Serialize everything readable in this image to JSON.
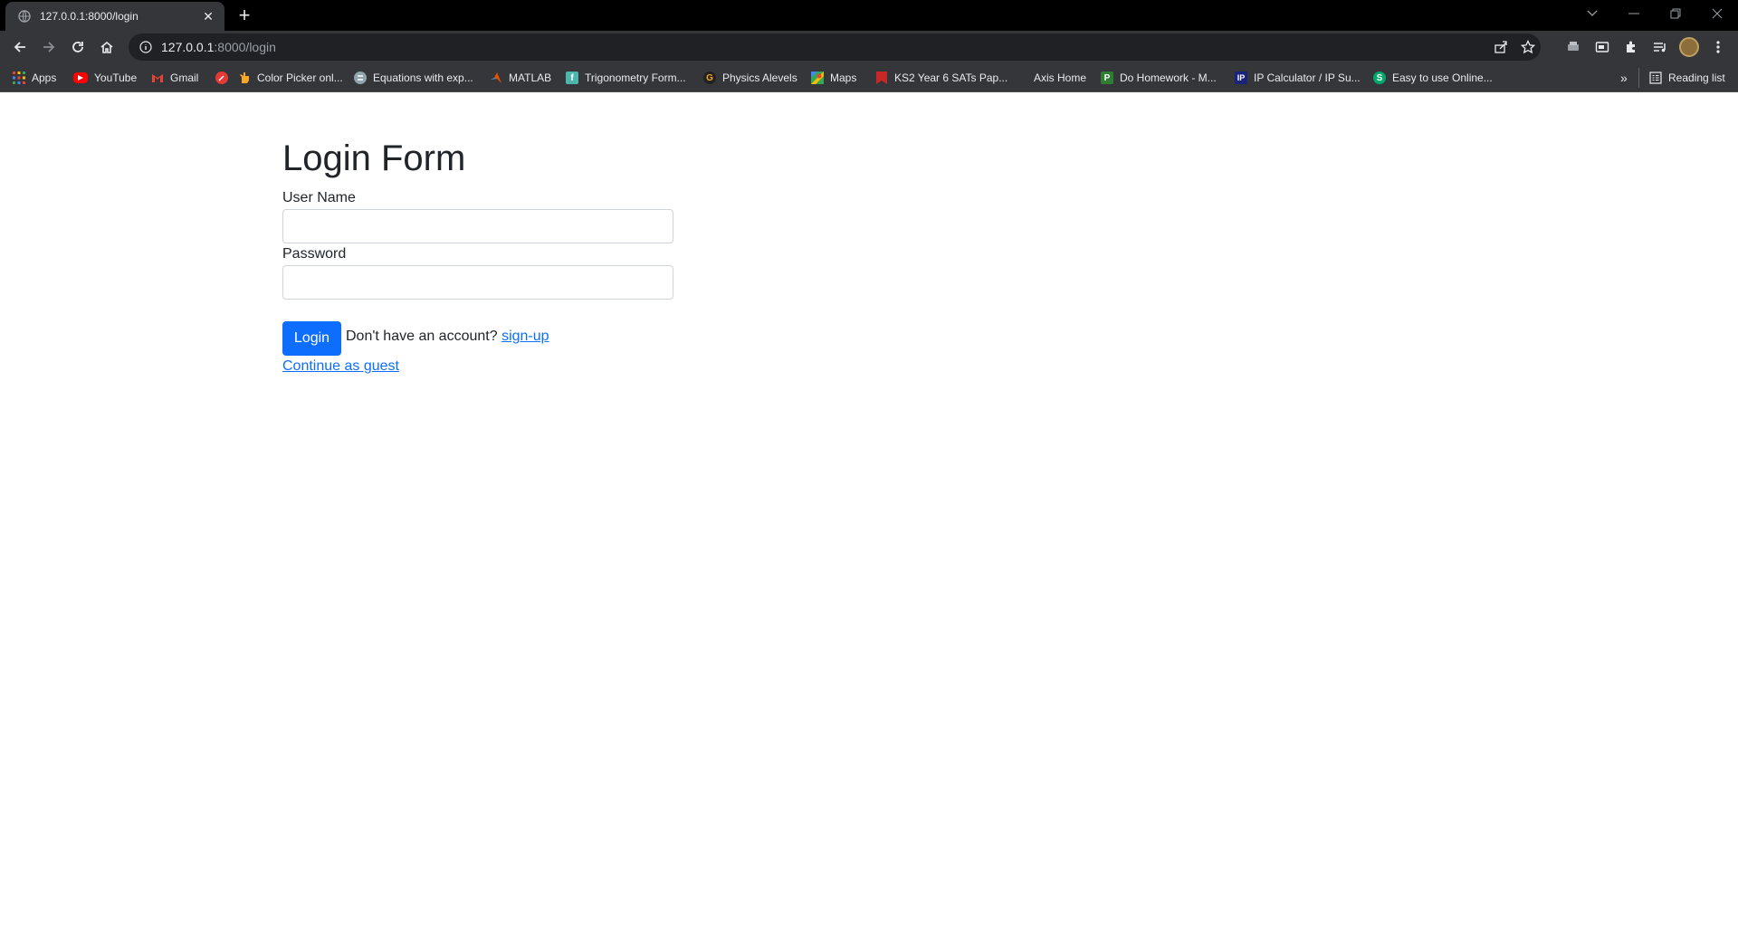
{
  "browser": {
    "tab_title": "127.0.0.1:8000/login",
    "url_host": "127.0.0.1",
    "url_path": ":8000/login",
    "bookmarks": [
      {
        "label": "Apps",
        "icon": "apps-grid-icon",
        "color": "#ea4335"
      },
      {
        "label": "YouTube",
        "icon": "youtube-icon",
        "color": "#ff0000"
      },
      {
        "label": "Gmail",
        "icon": "gmail-icon",
        "color": "#ea4335"
      },
      {
        "label": "",
        "icon": "color-picker-icon",
        "color": "#e53935"
      },
      {
        "label": "Color Picker onl...",
        "icon": "hand-icon",
        "color": "#f9a825"
      },
      {
        "label": "Equations with exp...",
        "icon": "equations-icon",
        "color": "#78909c"
      },
      {
        "label": "MATLAB",
        "icon": "matlab-icon",
        "color": "#e65100"
      },
      {
        "label": "Trigonometry Form...",
        "icon": "trig-icon",
        "color": "#26a69a"
      },
      {
        "label": "Physics Alevels",
        "icon": "physics-icon",
        "color": "#424242"
      },
      {
        "label": "Maps",
        "icon": "maps-icon",
        "color": "#34a853"
      },
      {
        "label": "KS2 Year 6 SATs Pap...",
        "icon": "ks2-icon",
        "color": "#c62828"
      },
      {
        "label": "Axis Home",
        "icon": "",
        "color": ""
      },
      {
        "label": "Do Homework - M...",
        "icon": "homework-icon",
        "color": "#2e7d32"
      },
      {
        "label": "IP Calculator / IP Su...",
        "icon": "ip-icon",
        "color": "#1a237e"
      },
      {
        "label": "Easy to use Online...",
        "icon": "easy-icon",
        "color": "#00a86b"
      }
    ],
    "reading_list": "Reading list",
    "overflow_label": "»"
  },
  "login": {
    "heading": "Login Form",
    "username_label": "User Name",
    "username_value": "",
    "password_label": "Password",
    "password_value": "",
    "login_button": "Login",
    "no_account_text": "Don't have an account? ",
    "signup_link": "sign-up",
    "guest_link": "Continue as guest"
  },
  "colors": {
    "primary": "#0d6efd",
    "browser_dark": "#35363a"
  }
}
